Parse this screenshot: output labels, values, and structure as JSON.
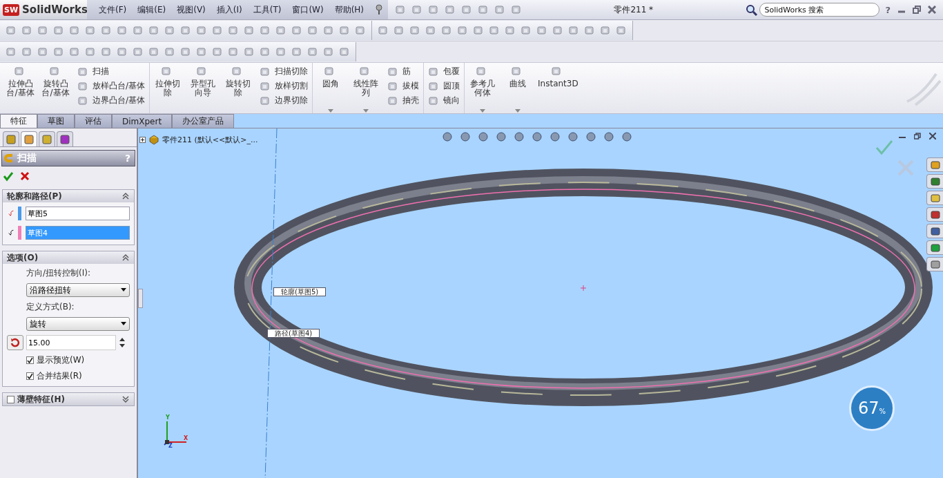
{
  "app": {
    "logo_mark": "SW",
    "logo_text": "SolidWorks"
  },
  "menu": [
    {
      "label": "文件(F)"
    },
    {
      "label": "编辑(E)"
    },
    {
      "label": "视图(V)"
    },
    {
      "label": "插入(I)"
    },
    {
      "label": "工具(T)"
    },
    {
      "label": "窗口(W)"
    },
    {
      "label": "帮助(H)"
    }
  ],
  "document_title": "零件211 *",
  "search": {
    "placeholder": "SolidWorks 搜索"
  },
  "help": "?",
  "ribbon": [
    {
      "kind": "large",
      "label": "拉伸凸台/基体"
    },
    {
      "kind": "large",
      "label": "旋转凸台/基体"
    },
    {
      "kind": "stack",
      "items": [
        "扫描",
        "放样凸台/基体",
        "边界凸台/基体"
      ]
    },
    {
      "kind": "large",
      "label": "拉伸切除"
    },
    {
      "kind": "large",
      "label": "异型孔向导"
    },
    {
      "kind": "large",
      "label": "旋转切除"
    },
    {
      "kind": "stack",
      "items": [
        "扫描切除",
        "放样切割",
        "边界切除"
      ]
    },
    {
      "kind": "large",
      "label": "圆角",
      "dropdown": true
    },
    {
      "kind": "large",
      "label": "线性阵列",
      "dropdown": true
    },
    {
      "kind": "stack",
      "items": [
        "筋",
        "拔模",
        "抽壳"
      ]
    },
    {
      "kind": "stack",
      "items": [
        "包覆",
        "圆顶",
        "镜向"
      ]
    },
    {
      "kind": "large",
      "label": "参考几何体",
      "dropdown": true
    },
    {
      "kind": "large",
      "label": "曲线",
      "dropdown": true
    },
    {
      "kind": "wide",
      "label": "Instant3D"
    }
  ],
  "tabs": [
    {
      "label": "特征",
      "selected": true
    },
    {
      "label": "草图",
      "selected": false
    },
    {
      "label": "评估",
      "selected": false
    },
    {
      "label": "DimXpert",
      "selected": false
    },
    {
      "label": "办公室产品",
      "selected": false
    }
  ],
  "panel_tabs": [
    {
      "selected": false
    },
    {
      "selected": true
    },
    {
      "selected": false
    },
    {
      "selected": false
    }
  ],
  "property_manager": {
    "title": "扫描",
    "help": "?",
    "sections": [
      {
        "kind": "profile",
        "title": "轮廓和路径(P)",
        "expanded": true,
        "fields": [
          {
            "value": "草图5",
            "color": "#4a9ae8",
            "selected": false
          },
          {
            "value": "草图4",
            "color": "#f080b8",
            "selected": true
          }
        ]
      },
      {
        "kind": "options",
        "title": "选项(O)",
        "expanded": true,
        "label_1": "方向/扭转控制(I):",
        "dropdown_1": "沿路径扭转",
        "label_2": "定义方式(B):",
        "dropdown_2": "旋转",
        "number": "15.00",
        "checkboxes": [
          {
            "label": "显示预览(W)",
            "checked": true
          },
          {
            "label": "合并结果(R)",
            "checked": true
          }
        ]
      },
      {
        "kind": "thin",
        "title": "薄壁特征(H)",
        "expanded": false,
        "checked": false
      }
    ]
  },
  "viewport": {
    "tree_item": "零件211  (默认<<默认>_...",
    "callouts": [
      {
        "label": "轮廓(草图5)"
      },
      {
        "label": "路径(草图4)"
      }
    ],
    "axes": [
      "Y",
      "X",
      "Z"
    ],
    "badge": {
      "value": "67",
      "unit": "%"
    }
  }
}
